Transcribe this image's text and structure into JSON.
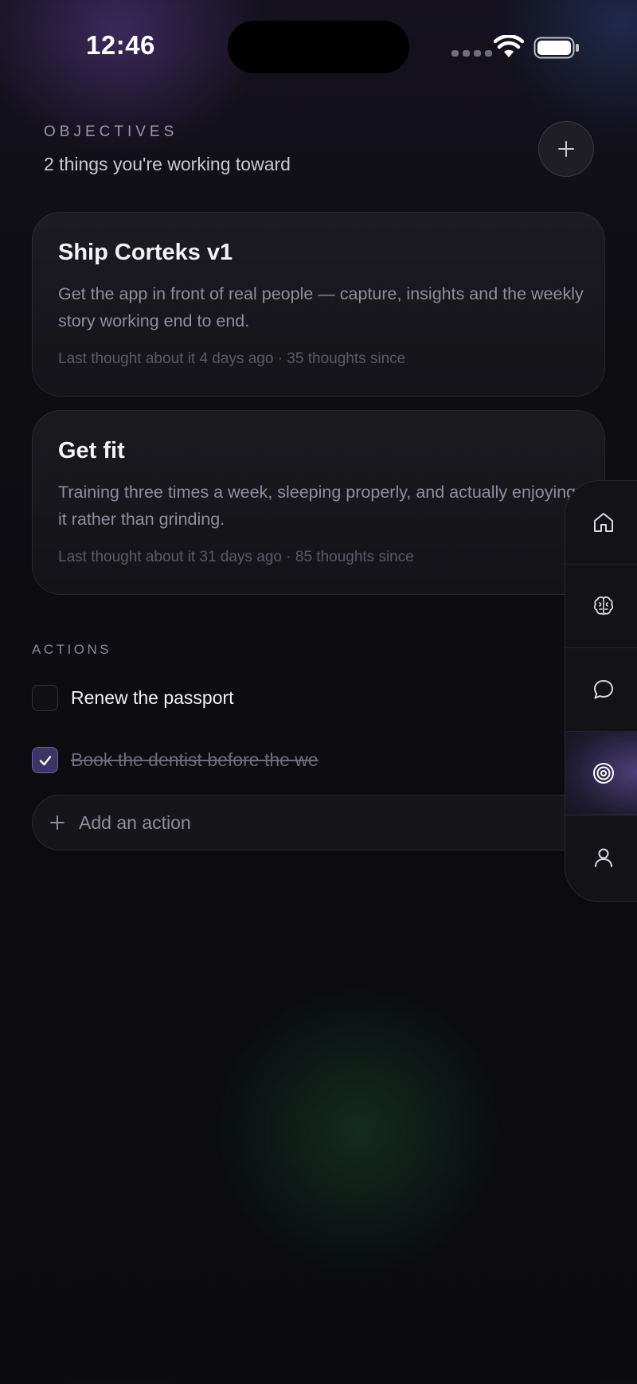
{
  "status_bar": {
    "time": "12:46"
  },
  "header": {
    "eyebrow": "OBJECTIVES",
    "subtitle": "2 things you're working toward",
    "add_icon": "plus-icon"
  },
  "objectives": [
    {
      "title": "Ship Corteks v1",
      "description": "Get the app in front of real people — capture, insights and the weekly story working end to end.",
      "meta": "Last thought about it 4 days ago · 35 thoughts since"
    },
    {
      "title": "Get fit",
      "description": "Training three times a week, sleeping properly, and actually enjoying it rather than grinding.",
      "meta": "Last thought about it 31 days ago · 85 thoughts since"
    }
  ],
  "actions": {
    "label": "ACTIONS",
    "items": [
      {
        "text": "Renew the passport",
        "done": false
      },
      {
        "text": "Book the dentist before the we",
        "done": true
      }
    ],
    "add_placeholder": "Add an action"
  },
  "nav": {
    "items": [
      {
        "icon": "home-icon",
        "active": false
      },
      {
        "icon": "brain-icon",
        "active": false
      },
      {
        "icon": "chat-icon",
        "active": false
      },
      {
        "icon": "target-icon",
        "active": true
      },
      {
        "icon": "profile-icon",
        "active": false
      }
    ]
  },
  "colors": {
    "accent": "#6a5ca8",
    "checked_fill": "#3d3466",
    "background": "#0d0d12"
  }
}
